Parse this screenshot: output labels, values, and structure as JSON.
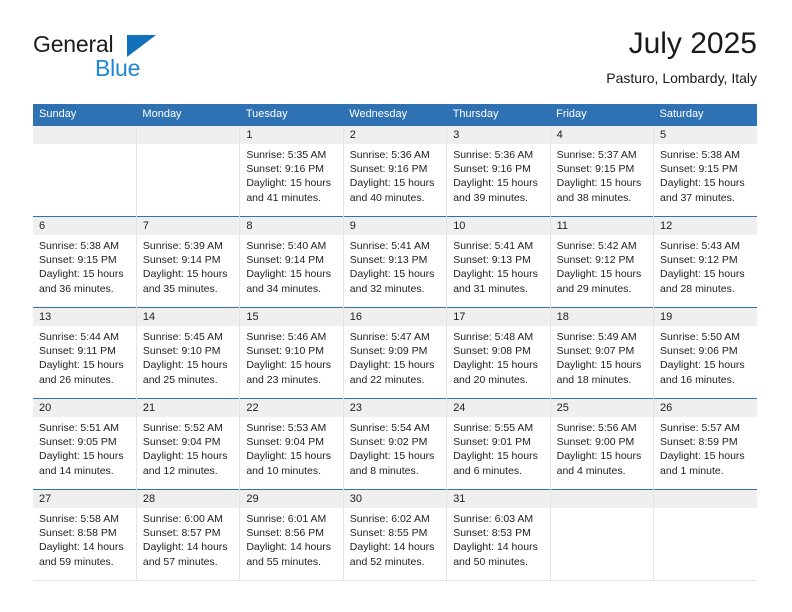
{
  "brand": {
    "word_one": "General",
    "word_two": "Blue",
    "triangle_color": "#1171ba",
    "blue_color": "#1e87d6"
  },
  "header": {
    "title": "July 2025",
    "subtitle": "Pasturo, Lombardy, Italy"
  },
  "theme": {
    "header_blue": "#2e72b4",
    "row_divider_blue": "#2e72b4",
    "daynum_band": "#efefef",
    "cell_border": "#e4e4e4"
  },
  "calendar": {
    "weekday_headers": [
      "Sunday",
      "Monday",
      "Tuesday",
      "Wednesday",
      "Thursday",
      "Friday",
      "Saturday"
    ],
    "labels": {
      "sunrise": "Sunrise:",
      "sunset": "Sunset:",
      "daylight": "Daylight:"
    },
    "weeks": [
      [
        {
          "day": "",
          "empty": true
        },
        {
          "day": "",
          "empty": true
        },
        {
          "day": "1",
          "sunrise": "Sunrise: 5:35 AM",
          "sunset": "Sunset: 9:16 PM",
          "daylight_l1": "Daylight: 15 hours",
          "daylight_l2": "and 41 minutes."
        },
        {
          "day": "2",
          "sunrise": "Sunrise: 5:36 AM",
          "sunset": "Sunset: 9:16 PM",
          "daylight_l1": "Daylight: 15 hours",
          "daylight_l2": "and 40 minutes."
        },
        {
          "day": "3",
          "sunrise": "Sunrise: 5:36 AM",
          "sunset": "Sunset: 9:16 PM",
          "daylight_l1": "Daylight: 15 hours",
          "daylight_l2": "and 39 minutes."
        },
        {
          "day": "4",
          "sunrise": "Sunrise: 5:37 AM",
          "sunset": "Sunset: 9:15 PM",
          "daylight_l1": "Daylight: 15 hours",
          "daylight_l2": "and 38 minutes."
        },
        {
          "day": "5",
          "sunrise": "Sunrise: 5:38 AM",
          "sunset": "Sunset: 9:15 PM",
          "daylight_l1": "Daylight: 15 hours",
          "daylight_l2": "and 37 minutes."
        }
      ],
      [
        {
          "day": "6",
          "sunrise": "Sunrise: 5:38 AM",
          "sunset": "Sunset: 9:15 PM",
          "daylight_l1": "Daylight: 15 hours",
          "daylight_l2": "and 36 minutes."
        },
        {
          "day": "7",
          "sunrise": "Sunrise: 5:39 AM",
          "sunset": "Sunset: 9:14 PM",
          "daylight_l1": "Daylight: 15 hours",
          "daylight_l2": "and 35 minutes."
        },
        {
          "day": "8",
          "sunrise": "Sunrise: 5:40 AM",
          "sunset": "Sunset: 9:14 PM",
          "daylight_l1": "Daylight: 15 hours",
          "daylight_l2": "and 34 minutes."
        },
        {
          "day": "9",
          "sunrise": "Sunrise: 5:41 AM",
          "sunset": "Sunset: 9:13 PM",
          "daylight_l1": "Daylight: 15 hours",
          "daylight_l2": "and 32 minutes."
        },
        {
          "day": "10",
          "sunrise": "Sunrise: 5:41 AM",
          "sunset": "Sunset: 9:13 PM",
          "daylight_l1": "Daylight: 15 hours",
          "daylight_l2": "and 31 minutes."
        },
        {
          "day": "11",
          "sunrise": "Sunrise: 5:42 AM",
          "sunset": "Sunset: 9:12 PM",
          "daylight_l1": "Daylight: 15 hours",
          "daylight_l2": "and 29 minutes."
        },
        {
          "day": "12",
          "sunrise": "Sunrise: 5:43 AM",
          "sunset": "Sunset: 9:12 PM",
          "daylight_l1": "Daylight: 15 hours",
          "daylight_l2": "and 28 minutes."
        }
      ],
      [
        {
          "day": "13",
          "sunrise": "Sunrise: 5:44 AM",
          "sunset": "Sunset: 9:11 PM",
          "daylight_l1": "Daylight: 15 hours",
          "daylight_l2": "and 26 minutes."
        },
        {
          "day": "14",
          "sunrise": "Sunrise: 5:45 AM",
          "sunset": "Sunset: 9:10 PM",
          "daylight_l1": "Daylight: 15 hours",
          "daylight_l2": "and 25 minutes."
        },
        {
          "day": "15",
          "sunrise": "Sunrise: 5:46 AM",
          "sunset": "Sunset: 9:10 PM",
          "daylight_l1": "Daylight: 15 hours",
          "daylight_l2": "and 23 minutes."
        },
        {
          "day": "16",
          "sunrise": "Sunrise: 5:47 AM",
          "sunset": "Sunset: 9:09 PM",
          "daylight_l1": "Daylight: 15 hours",
          "daylight_l2": "and 22 minutes."
        },
        {
          "day": "17",
          "sunrise": "Sunrise: 5:48 AM",
          "sunset": "Sunset: 9:08 PM",
          "daylight_l1": "Daylight: 15 hours",
          "daylight_l2": "and 20 minutes."
        },
        {
          "day": "18",
          "sunrise": "Sunrise: 5:49 AM",
          "sunset": "Sunset: 9:07 PM",
          "daylight_l1": "Daylight: 15 hours",
          "daylight_l2": "and 18 minutes."
        },
        {
          "day": "19",
          "sunrise": "Sunrise: 5:50 AM",
          "sunset": "Sunset: 9:06 PM",
          "daylight_l1": "Daylight: 15 hours",
          "daylight_l2": "and 16 minutes."
        }
      ],
      [
        {
          "day": "20",
          "sunrise": "Sunrise: 5:51 AM",
          "sunset": "Sunset: 9:05 PM",
          "daylight_l1": "Daylight: 15 hours",
          "daylight_l2": "and 14 minutes."
        },
        {
          "day": "21",
          "sunrise": "Sunrise: 5:52 AM",
          "sunset": "Sunset: 9:04 PM",
          "daylight_l1": "Daylight: 15 hours",
          "daylight_l2": "and 12 minutes."
        },
        {
          "day": "22",
          "sunrise": "Sunrise: 5:53 AM",
          "sunset": "Sunset: 9:04 PM",
          "daylight_l1": "Daylight: 15 hours",
          "daylight_l2": "and 10 minutes."
        },
        {
          "day": "23",
          "sunrise": "Sunrise: 5:54 AM",
          "sunset": "Sunset: 9:02 PM",
          "daylight_l1": "Daylight: 15 hours",
          "daylight_l2": "and 8 minutes."
        },
        {
          "day": "24",
          "sunrise": "Sunrise: 5:55 AM",
          "sunset": "Sunset: 9:01 PM",
          "daylight_l1": "Daylight: 15 hours",
          "daylight_l2": "and 6 minutes."
        },
        {
          "day": "25",
          "sunrise": "Sunrise: 5:56 AM",
          "sunset": "Sunset: 9:00 PM",
          "daylight_l1": "Daylight: 15 hours",
          "daylight_l2": "and 4 minutes."
        },
        {
          "day": "26",
          "sunrise": "Sunrise: 5:57 AM",
          "sunset": "Sunset: 8:59 PM",
          "daylight_l1": "Daylight: 15 hours",
          "daylight_l2": "and 1 minute."
        }
      ],
      [
        {
          "day": "27",
          "sunrise": "Sunrise: 5:58 AM",
          "sunset": "Sunset: 8:58 PM",
          "daylight_l1": "Daylight: 14 hours",
          "daylight_l2": "and 59 minutes."
        },
        {
          "day": "28",
          "sunrise": "Sunrise: 6:00 AM",
          "sunset": "Sunset: 8:57 PM",
          "daylight_l1": "Daylight: 14 hours",
          "daylight_l2": "and 57 minutes."
        },
        {
          "day": "29",
          "sunrise": "Sunrise: 6:01 AM",
          "sunset": "Sunset: 8:56 PM",
          "daylight_l1": "Daylight: 14 hours",
          "daylight_l2": "and 55 minutes."
        },
        {
          "day": "30",
          "sunrise": "Sunrise: 6:02 AM",
          "sunset": "Sunset: 8:55 PM",
          "daylight_l1": "Daylight: 14 hours",
          "daylight_l2": "and 52 minutes."
        },
        {
          "day": "31",
          "sunrise": "Sunrise: 6:03 AM",
          "sunset": "Sunset: 8:53 PM",
          "daylight_l1": "Daylight: 14 hours",
          "daylight_l2": "and 50 minutes."
        },
        {
          "day": "",
          "empty": true
        },
        {
          "day": "",
          "empty": true
        }
      ]
    ]
  }
}
